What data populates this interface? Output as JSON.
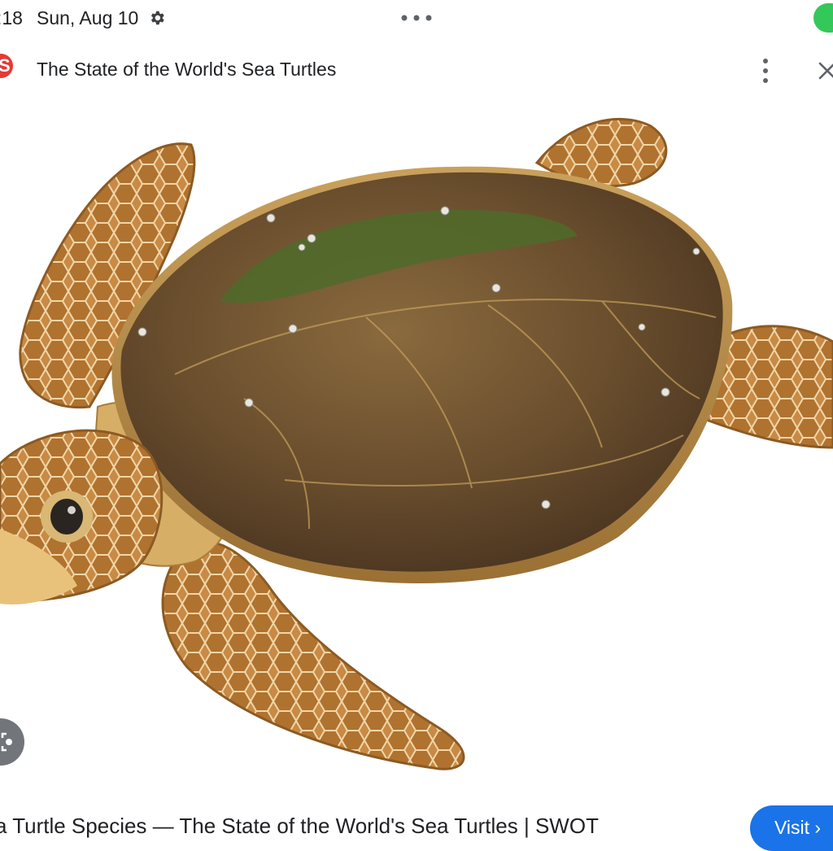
{
  "status_bar": {
    "time": ":18",
    "date": "Sun, Aug 10"
  },
  "header": {
    "site_logo_letter": "S",
    "title": "The State of the World's Sea Turtles"
  },
  "caption": {
    "text": "a Turtle Species — The State of the World's Sea Turtles | SWOT"
  },
  "visit_button": {
    "label": "Visit ›"
  },
  "colors": {
    "brand_red": "#e53935",
    "accent_blue": "#1a73e8",
    "status_green": "#34c759"
  },
  "icons": [
    "gear-icon",
    "more-horizontal-icon",
    "more-vertical-icon",
    "close-icon",
    "lens-icon",
    "chevron-right-icon"
  ]
}
